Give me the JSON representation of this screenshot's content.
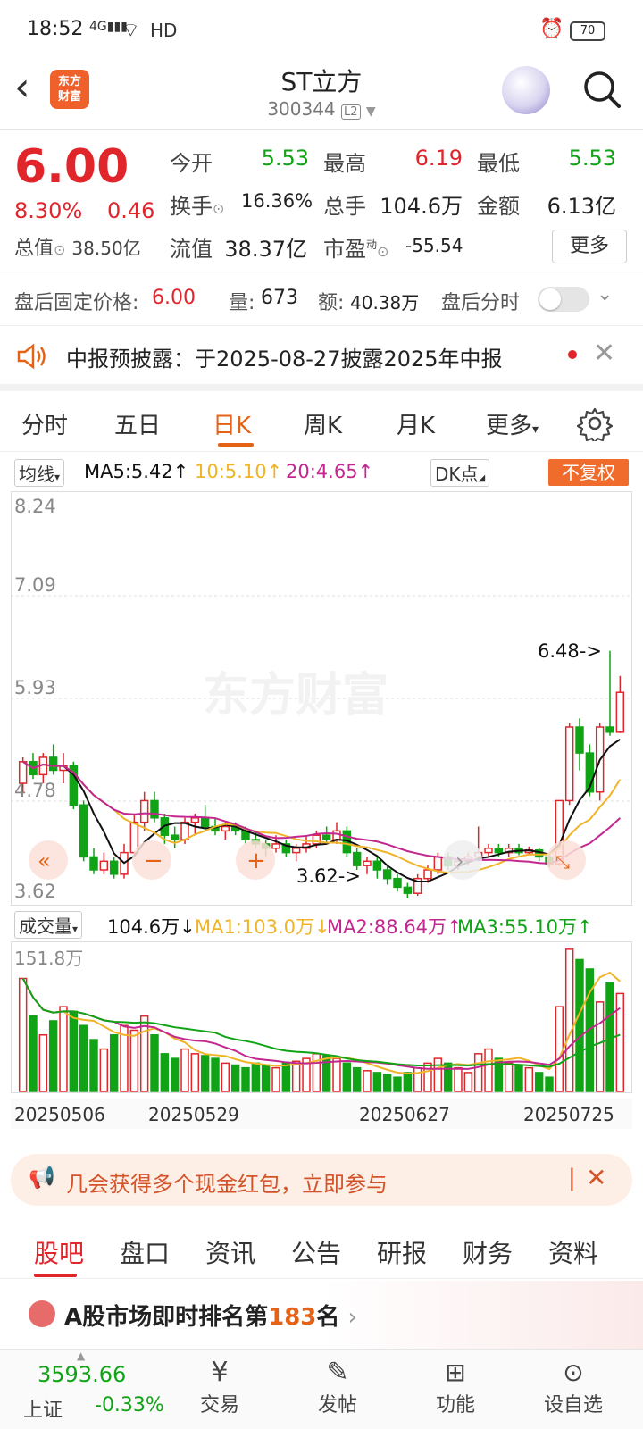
{
  "status": {
    "time": "18:52",
    "signal": "4G",
    "network": "HD",
    "battery": "70"
  },
  "header": {
    "title": "ST立方",
    "code": "300344",
    "level": "L2",
    "logo_line1": "东方",
    "logo_line2": "财富"
  },
  "quote": {
    "price": "6.00",
    "change_pct": "8.30%",
    "change": "0.46",
    "open_label": "今开",
    "open": "5.53",
    "high_label": "最高",
    "high": "6.19",
    "low_label": "最低",
    "low": "5.53",
    "turnover_label": "换手",
    "turnover": "16.36%",
    "volume_label": "总手",
    "volume": "104.6万",
    "amount_label": "金额",
    "amount": "6.13亿",
    "mktcap_label": "总值",
    "mktcap": "38.50亿",
    "float_label": "流值",
    "float_cap": "38.37亿",
    "pe_label": "市盈",
    "pe_sup": "动",
    "pe": "-55.54",
    "more": "更多"
  },
  "after_hours": {
    "price_label": "盘后固定价格:",
    "price": "6.00",
    "vol_label": "量:",
    "vol": "673",
    "amt_label": "额:",
    "amt": "40.38万",
    "timeshare_label": "盘后分时"
  },
  "notice": {
    "text": "中报预披露：于2025-08-27披露2025年中报"
  },
  "ktabs": [
    "分时",
    "五日",
    "日K",
    "周K",
    "月K",
    "更多"
  ],
  "ma": {
    "select": "均线",
    "ma5": "MA5:5.42↑",
    "ma10": "10:5.10↑",
    "ma20": "20:4.65↑",
    "dk": "DK点",
    "fq": "不复权"
  },
  "price_axis": {
    "top": "8.24",
    "l2": "7.09",
    "l3": "5.93",
    "l4": "4.78",
    "bottom": "3.62"
  },
  "annotations": {
    "high": "6.48->",
    "low": "3.62->"
  },
  "watermark": "东方财富",
  "vol": {
    "select": "成交量",
    "value": "104.6万↓",
    "ma1": "MA1:103.0万↓",
    "ma2": "MA2:88.64万↑",
    "ma3": "MA3:55.10万↑",
    "axis_top": "151.8万"
  },
  "dates": [
    "20250506",
    "20250529",
    "20250627",
    "20250725"
  ],
  "banner": {
    "text": "几会获得多个现金红包，立即参与"
  },
  "btabs": [
    "股吧",
    "盘口",
    "资讯",
    "公告",
    "研报",
    "财务",
    "资料"
  ],
  "rank": {
    "prefix": "A股市场即时排名第",
    "num": "183",
    "suffix": "名"
  },
  "footer": {
    "index_value": "3593.66",
    "index_name": "上证",
    "index_change": "-0.33%",
    "items": [
      "交易",
      "发帖",
      "功能",
      "设自选"
    ]
  },
  "colors": {
    "up": "#e0252b",
    "down": "#11a316",
    "accent": "#e56317",
    "ma5": "#111111",
    "ma10": "#f0b429",
    "ma20": "#c2278f"
  },
  "candles": [
    [
      4.95,
      5.2,
      5.25,
      4.85
    ],
    [
      5.2,
      5.05,
      5.3,
      5.0
    ],
    [
      5.05,
      5.25,
      5.3,
      4.95
    ],
    [
      5.25,
      5.1,
      5.4,
      5.05
    ],
    [
      5.1,
      5.15,
      5.3,
      4.95
    ],
    [
      5.15,
      4.7,
      5.2,
      4.65
    ],
    [
      4.7,
      4.1,
      4.75,
      4.05
    ],
    [
      4.1,
      3.95,
      4.2,
      3.9
    ],
    [
      3.95,
      4.05,
      4.15,
      3.9
    ],
    [
      4.05,
      3.9,
      4.1,
      3.85
    ],
    [
      3.9,
      4.15,
      4.25,
      3.85
    ],
    [
      4.15,
      4.5,
      4.6,
      4.1
    ],
    [
      4.5,
      4.75,
      4.85,
      4.4
    ],
    [
      4.75,
      4.55,
      4.85,
      4.5
    ],
    [
      4.55,
      4.35,
      4.6,
      4.25
    ],
    [
      4.35,
      4.3,
      4.45,
      4.2
    ],
    [
      4.3,
      4.5,
      4.55,
      4.25
    ],
    [
      4.5,
      4.55,
      4.6,
      4.35
    ],
    [
      4.55,
      4.45,
      4.7,
      4.4
    ],
    [
      4.45,
      4.4,
      4.55,
      4.35
    ],
    [
      4.4,
      4.45,
      4.5,
      4.3
    ],
    [
      4.45,
      4.4,
      4.5,
      4.35
    ],
    [
      4.4,
      4.3,
      4.45,
      4.25
    ],
    [
      4.3,
      4.25,
      4.4,
      4.2
    ],
    [
      4.25,
      4.2,
      4.3,
      4.1
    ],
    [
      4.2,
      4.25,
      4.35,
      4.15
    ],
    [
      4.25,
      4.15,
      4.3,
      4.1
    ],
    [
      4.15,
      4.2,
      4.25,
      4.05
    ],
    [
      4.2,
      4.25,
      4.35,
      4.15
    ],
    [
      4.25,
      4.35,
      4.4,
      4.2
    ],
    [
      4.35,
      4.3,
      4.45,
      4.25
    ],
    [
      4.3,
      4.4,
      4.5,
      4.25
    ],
    [
      4.4,
      4.15,
      4.45,
      4.1
    ],
    [
      4.15,
      4.0,
      4.2,
      3.95
    ],
    [
      4.0,
      4.05,
      4.1,
      3.9
    ],
    [
      4.05,
      3.95,
      4.1,
      3.85
    ],
    [
      3.95,
      3.85,
      4.0,
      3.78
    ],
    [
      3.85,
      3.75,
      3.9,
      3.7
    ],
    [
      3.75,
      3.68,
      3.8,
      3.62
    ],
    [
      3.68,
      3.85,
      3.9,
      3.65
    ],
    [
      3.85,
      3.95,
      4.0,
      3.8
    ],
    [
      3.95,
      4.1,
      4.15,
      3.9
    ],
    [
      4.1,
      4.0,
      4.15,
      3.95
    ],
    [
      4.0,
      4.05,
      4.1,
      3.95
    ],
    [
      4.05,
      4.1,
      4.15,
      4.0
    ],
    [
      4.1,
      4.15,
      4.45,
      4.05
    ],
    [
      4.15,
      4.2,
      4.25,
      4.1
    ],
    [
      4.2,
      4.15,
      4.25,
      4.1
    ],
    [
      4.15,
      4.2,
      4.25,
      4.1
    ],
    [
      4.2,
      4.15,
      4.25,
      4.12
    ],
    [
      4.15,
      4.18,
      4.22,
      4.12
    ],
    [
      4.18,
      4.1,
      4.2,
      4.05
    ],
    [
      4.1,
      4.02,
      4.12,
      3.98
    ],
    [
      4.02,
      4.75,
      4.75,
      4.0
    ],
    [
      4.75,
      5.6,
      5.65,
      4.7
    ],
    [
      5.6,
      5.3,
      5.7,
      5.1
    ],
    [
      5.3,
      4.85,
      5.4,
      4.8
    ],
    [
      4.85,
      5.6,
      5.65,
      4.75
    ],
    [
      5.6,
      5.54,
      6.48,
      5.5
    ],
    [
      5.54,
      6.0,
      6.19,
      5.53
    ]
  ],
  "volumes": [
    120,
    80,
    60,
    75,
    90,
    85,
    70,
    55,
    45,
    60,
    70,
    65,
    80,
    60,
    40,
    35,
    45,
    40,
    38,
    35,
    30,
    28,
    25,
    30,
    28,
    25,
    30,
    32,
    35,
    40,
    38,
    35,
    30,
    25,
    22,
    20,
    18,
    15,
    20,
    25,
    30,
    35,
    30,
    25,
    20,
    40,
    45,
    35,
    30,
    28,
    25,
    20,
    15,
    90,
    151,
    140,
    130,
    95,
    115,
    104
  ]
}
